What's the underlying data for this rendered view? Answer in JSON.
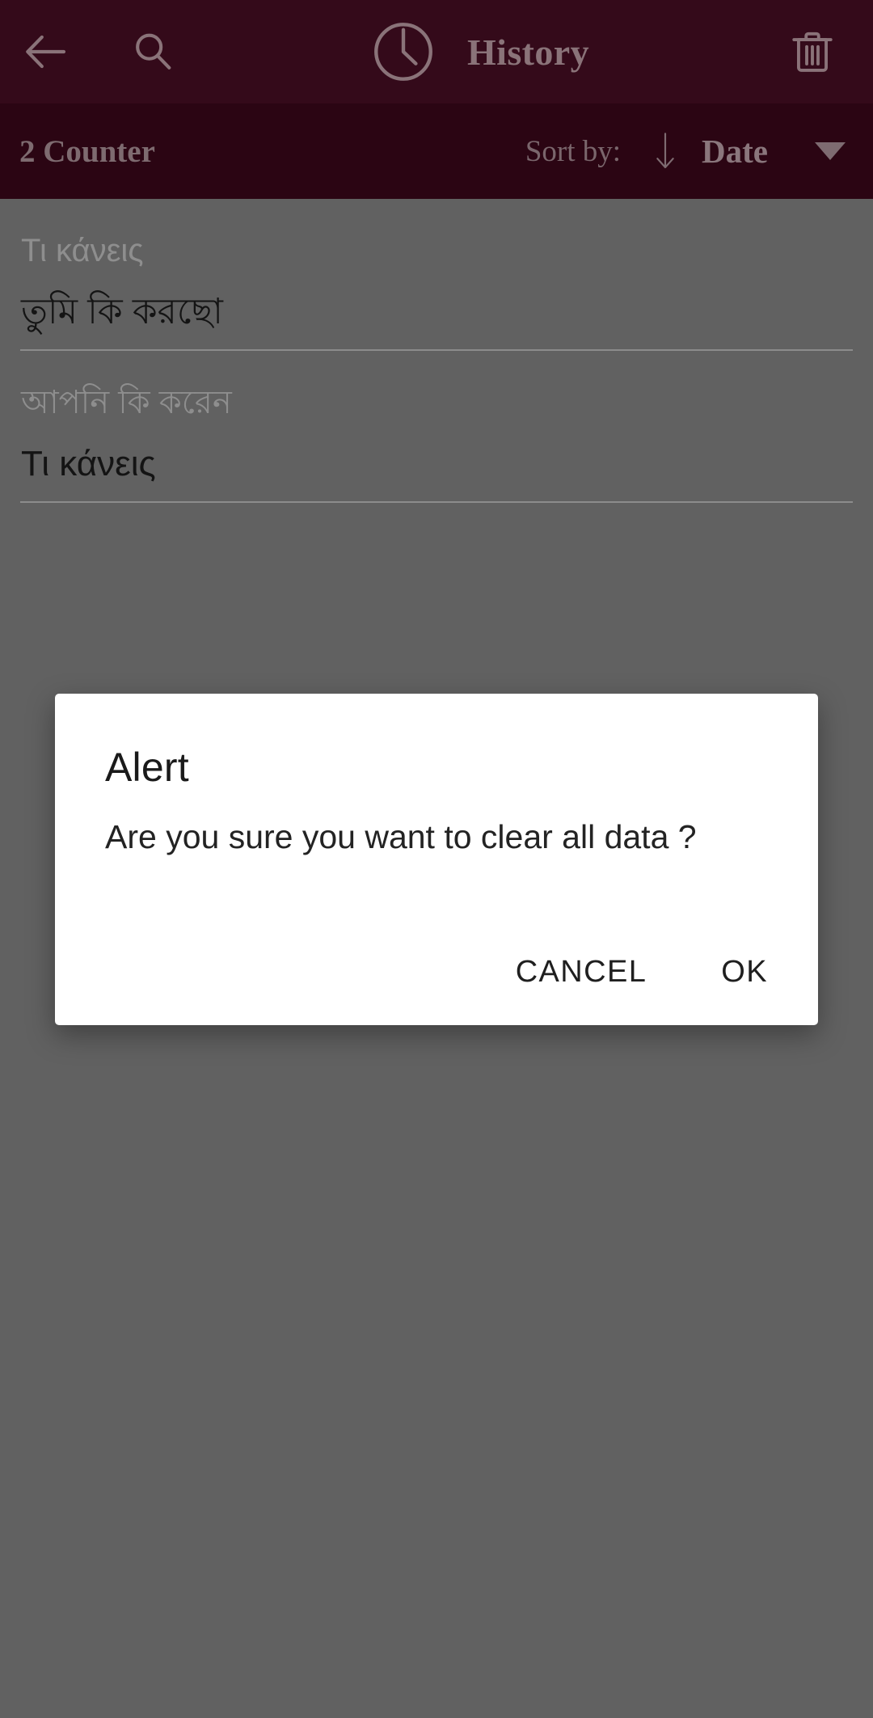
{
  "theme": {
    "appbar_bg": "#340A1A",
    "sortbar_bg": "#2B0513",
    "appbar_fg": "#8A7379",
    "scrim_bg": "#616161",
    "dialog_bg": "#FFFFFF",
    "list_primary_text": "#141414",
    "list_secondary_text": "#8E8E8E",
    "divider": "#8C8C8C"
  },
  "appbar": {
    "back_icon": "back-arrow-icon",
    "search_icon": "search-icon",
    "clock_icon": "clock-icon",
    "title": "History",
    "delete_icon": "trash-icon"
  },
  "sortbar": {
    "counter": "2 Counter",
    "sort_by_label": "Sort by:",
    "sort_direction_icon": "arrow-down-icon",
    "sort_field": "Date",
    "dropdown_icon": "caret-down-icon"
  },
  "history": {
    "items": [
      {
        "source": "Τι κάνεις",
        "target": "তুমি কি করছো"
      },
      {
        "source": "আপনি কি করেন",
        "target": "Τι κάνεις"
      }
    ]
  },
  "dialog": {
    "title": "Alert",
    "message": "Are you sure you want to clear all data ?",
    "cancel_label": "CANCEL",
    "ok_label": "OK"
  }
}
